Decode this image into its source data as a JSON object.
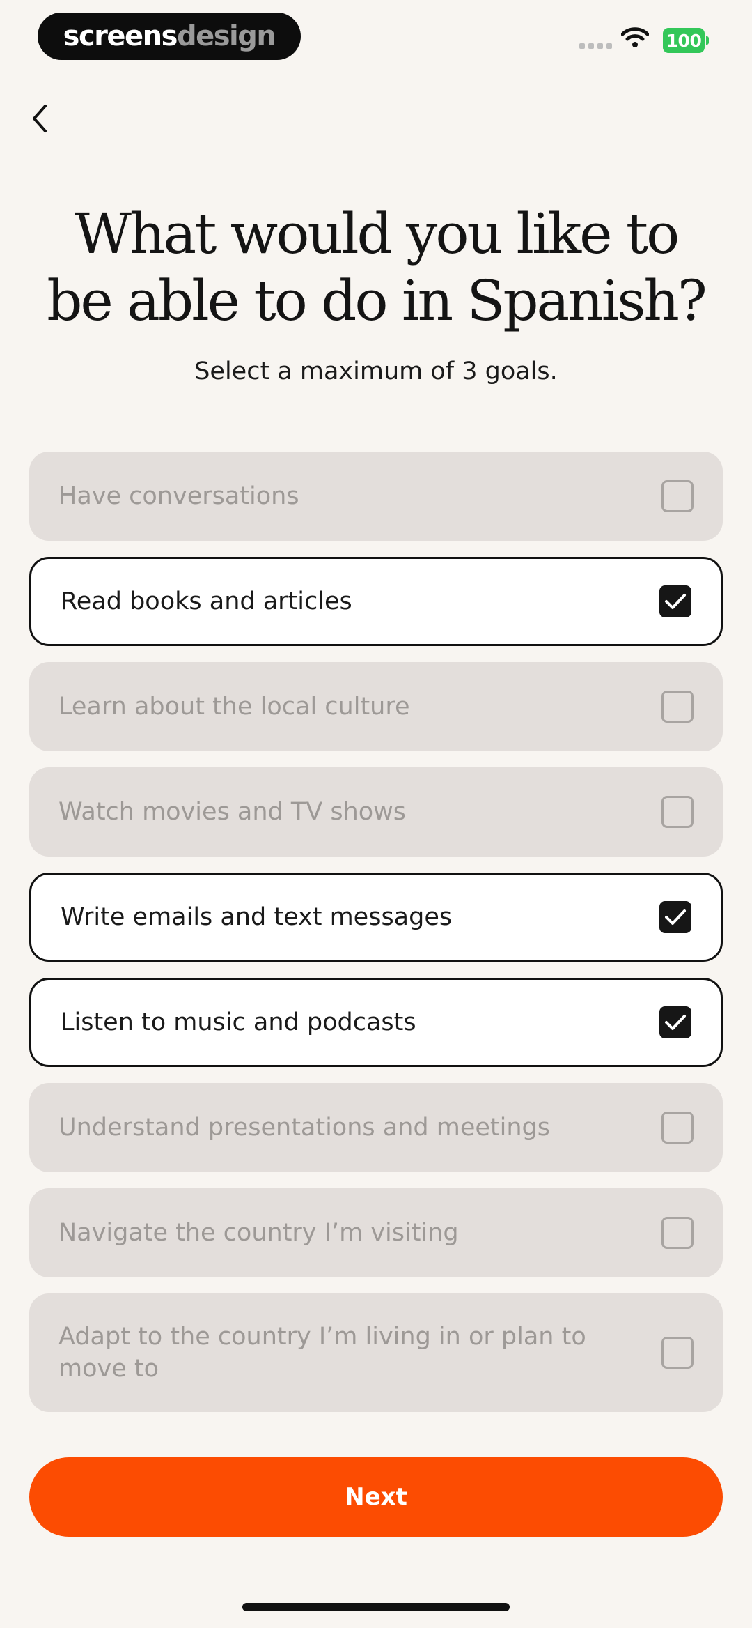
{
  "status_bar": {
    "brand_primary": "screens",
    "brand_secondary": "design",
    "battery": "100",
    "battery_color": "#33c759"
  },
  "nav": {
    "back_icon": "chevron-left-icon"
  },
  "header": {
    "title": "What would you like to be able to do in Spanish?",
    "subtitle": "Select a maximum of 3 goals."
  },
  "goals": [
    {
      "label": "Have conversations",
      "selected": false
    },
    {
      "label": "Read books and articles",
      "selected": true
    },
    {
      "label": "Learn about the local culture",
      "selected": false
    },
    {
      "label": "Watch movies and TV shows",
      "selected": false
    },
    {
      "label": "Write emails and text messages",
      "selected": true
    },
    {
      "label": "Listen to music and podcasts",
      "selected": true
    },
    {
      "label": "Understand presentations and meetings",
      "selected": false
    },
    {
      "label": "Navigate the country I’m visiting",
      "selected": false
    },
    {
      "label": "Adapt to the country I’m living in or plan to move to",
      "selected": false
    }
  ],
  "footer": {
    "next_label": "Next",
    "accent_color": "#fc4c02"
  }
}
